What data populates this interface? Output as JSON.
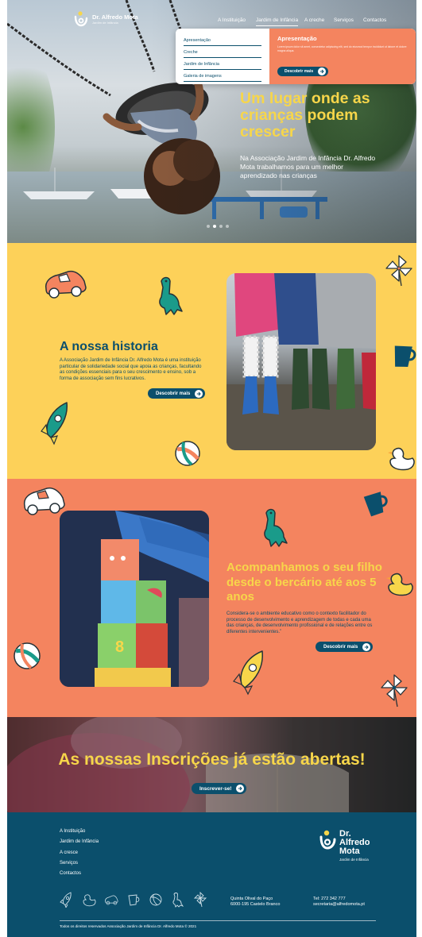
{
  "brand": {
    "name": "Dr. Alfredo Mota",
    "subtitle": "Jardim de Infância",
    "footer_name_lines": [
      "Dr.",
      "Alfredo",
      "Mota"
    ]
  },
  "nav": {
    "items": [
      "A Instituição",
      "Jardim de Infância",
      "A creche",
      "Serviços",
      "Contactos"
    ],
    "active": "Jardim de Infância"
  },
  "dropdown": {
    "items": [
      "Apresentação",
      "Creche",
      "Jardim de Infância",
      "Galeria de imagens"
    ],
    "panel_title": "Apresentação",
    "panel_text": "Lorem ipsum dolor sit amet, consectetur adipiscing elit, sed do eiusmod tempor incididunt ut labore et dolore magna aliqua.",
    "button": "Descobrir mais"
  },
  "hero": {
    "heading": "Um lugar onde as crianças podem crescer",
    "subheading": "Na Associação Jardim de Infância Dr. Alfredo Mota trabalhamos para um melhor aprendizado nas crianças",
    "slides": 4,
    "active_slide": 2
  },
  "story": {
    "title": "A nossa historia",
    "text": "A Associação Jardim de Infância Dr. Alfredo Mota é uma instituição particular de solidariedade social que apoia as crianças, facultando as condições essenciais para o seu crescimento e ensino, sob a forma de associação sem fins lucrativos.",
    "button": "Descobrir mais"
  },
  "follow": {
    "title": "Acompanhamos o seu filho desde o bercário até aos 5 anos",
    "text": "Considera-se o ambiente educativo como o contexto facilitador do processo de desenvolvimento e aprendizagem de todas e cada uma das crianças, de desenvolvimento profissional e de relações entre os diferentes intervenientes.”",
    "button": "Descobrir mais"
  },
  "signup": {
    "title": "As nossas Inscrições já estão abertas!",
    "button": "Inscrever-se!"
  },
  "footer": {
    "links": [
      "A Instituição",
      "Jardim de Infância",
      "A cresce",
      "Serviços",
      "Contactos"
    ],
    "address": [
      "Quinta Olival do Paço",
      "6000-195 Castelo Branco"
    ],
    "contact": [
      "Tel: 272 342 777",
      "secretaria@alfredomota.pt"
    ],
    "copyright": "Todos os direitos reservados Associação Jardim de Infância Dr. Alfredo Mota © 2021"
  },
  "colors": {
    "yellow": "#fdd159",
    "coral": "#f4845f",
    "navy": "#0b4f6c",
    "heading_yellow": "#f7d64a",
    "teal": "#1a9b8a"
  },
  "icons": [
    "car-icon",
    "dinosaur-icon",
    "rocket-icon",
    "ball-icon",
    "pinwheel-icon",
    "cup-icon",
    "duck-icon",
    "arrow-right-icon"
  ]
}
